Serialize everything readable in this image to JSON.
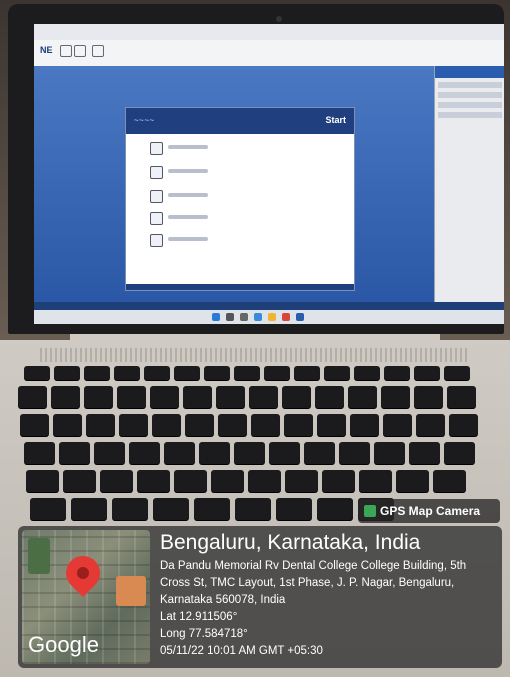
{
  "overlay": {
    "app_badge": "GPS Map Camera",
    "city": "Bengaluru, Karnataka, India",
    "address": "Da Pandu Memorial Rv Dental College College Building, 5th Cross St, TMC Layout, 1st Phase, J. P. Nagar, Bengaluru, Karnataka 560078, India",
    "lat": "Lat 12.911506°",
    "long": "Long 77.584718°",
    "datetime": "05/11/22 10:01 AM GMT +05:30",
    "map_brand": "Google",
    "icons": [
      "map-pin-icon",
      "gps-camera-icon"
    ]
  },
  "laptop_screen": {
    "dialog_title": "Start",
    "app_logo_short": "NE"
  },
  "colors": {
    "screen_blue": "#2f5ea8",
    "dialog_header": "#1f3f7e",
    "pin_red": "#e53935",
    "overlay_bg": "#373737"
  }
}
